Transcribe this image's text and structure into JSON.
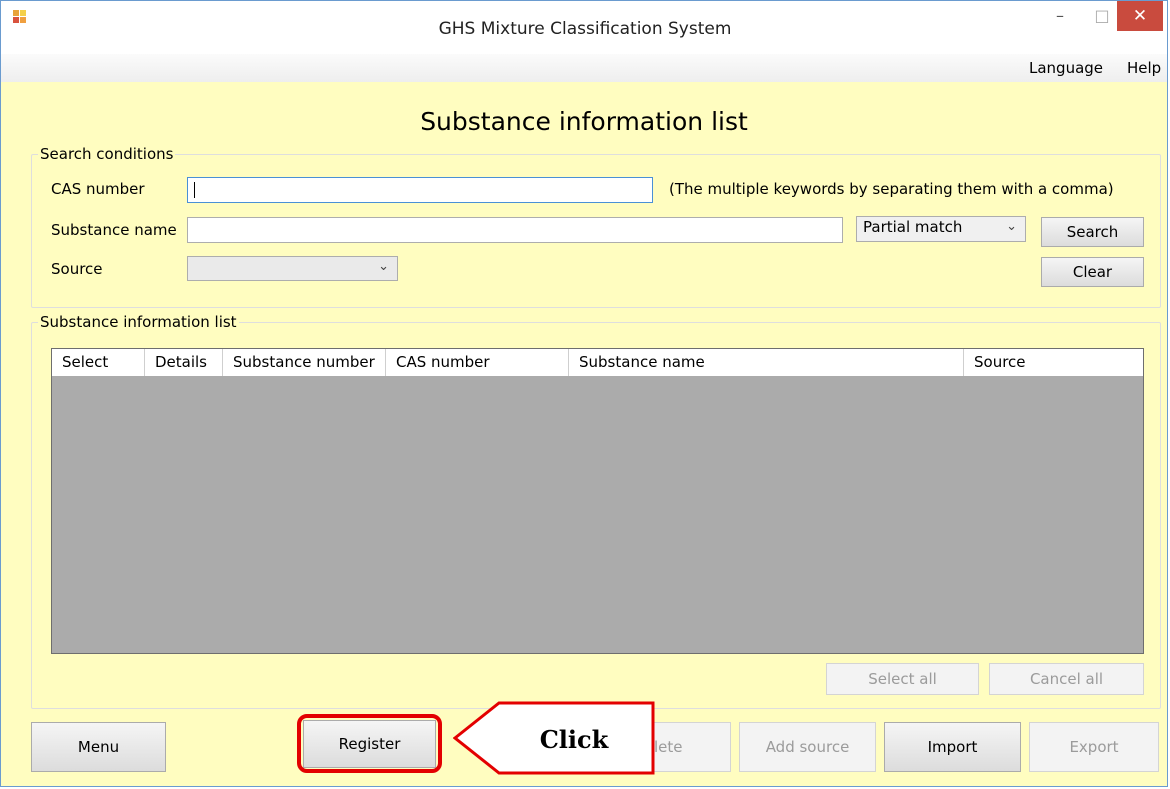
{
  "window": {
    "title": "GHS Mixture Classification System",
    "controls": {
      "minimize": "–",
      "maximize": "□",
      "close": "✕"
    }
  },
  "menubar": {
    "items": [
      "Language",
      "Help"
    ]
  },
  "page_title": "Substance information list",
  "search": {
    "legend": "Search conditions",
    "cas_label": "CAS number",
    "cas_value": "",
    "cas_note": "(The multiple keywords by separating them with a comma)",
    "name_label": "Substance name",
    "name_value": "",
    "match_mode": "Partial match",
    "source_label": "Source",
    "source_value": "",
    "search_button": "Search",
    "clear_button": "Clear"
  },
  "list": {
    "legend": "Substance information list",
    "columns": [
      "Select",
      "Details",
      "Substance number",
      "CAS number",
      "Substance name",
      "Source"
    ],
    "rows": [],
    "select_all_button": "Select all",
    "cancel_all_button": "Cancel all"
  },
  "footer": {
    "menu_button": "Menu",
    "register_button": "Register",
    "delete_button": "Delete",
    "delete_visible": "lete",
    "add_source_button": "Add source",
    "import_button": "Import",
    "export_button": "Export"
  },
  "annotation": {
    "callout_text": "Click",
    "highlight_color": "#e30000"
  },
  "colors": {
    "background": "#fffdc0",
    "grid_empty": "#ababab",
    "close_button": "#c94b3e"
  },
  "icons": {
    "app": "app-window-icon",
    "dropdown": "chevron-down-icon"
  }
}
